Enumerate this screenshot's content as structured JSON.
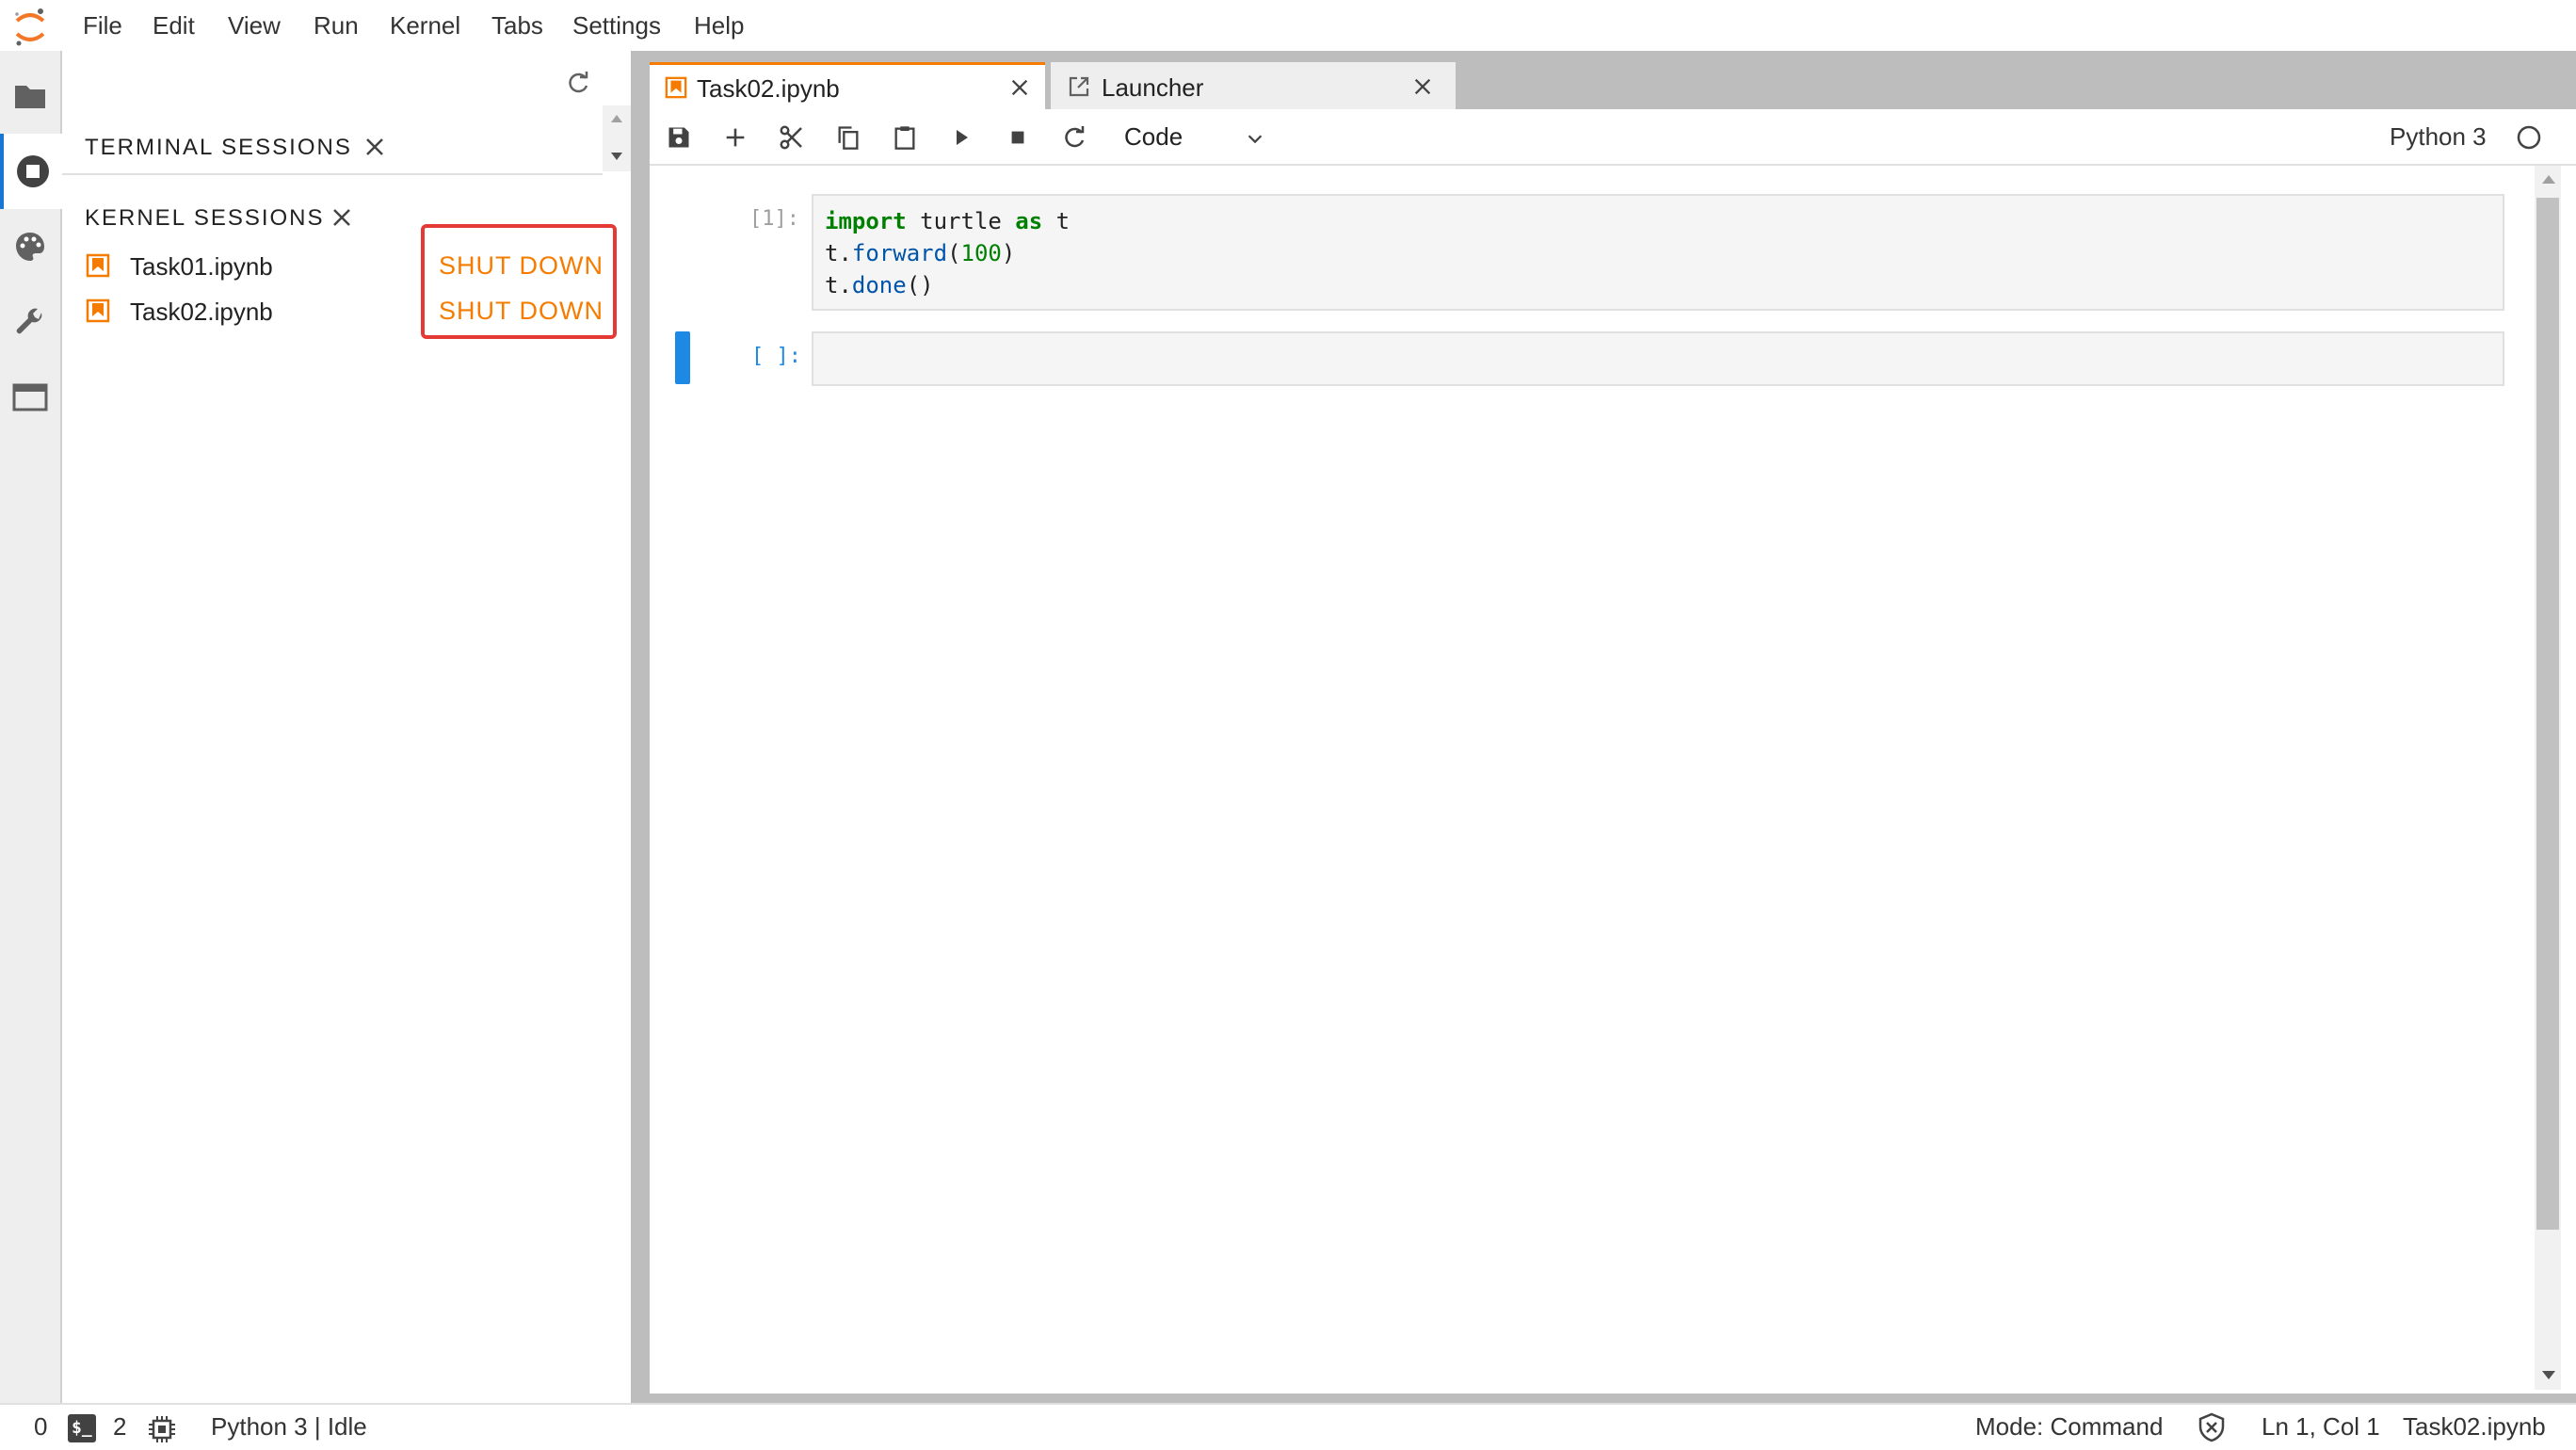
{
  "menubar": {
    "items": [
      "File",
      "Edit",
      "View",
      "Run",
      "Kernel",
      "Tabs",
      "Settings",
      "Help"
    ]
  },
  "sidebar": {
    "terminal_sessions_title": "TERMINAL SESSIONS",
    "kernel_sessions_title": "KERNEL SESSIONS",
    "sessions": [
      {
        "name": "Task01.ipynb",
        "action": "SHUT DOWN"
      },
      {
        "name": "Task02.ipynb",
        "action": "SHUT DOWN"
      }
    ]
  },
  "tabs": [
    {
      "label": "Task02.ipynb",
      "icon": "notebook-icon"
    },
    {
      "label": "Launcher",
      "icon": "launcher-icon"
    }
  ],
  "toolbar": {
    "cell_type": "Code",
    "kernel_name": "Python 3"
  },
  "cells": [
    {
      "prompt": "[1]:",
      "lines": [
        "import turtle as t",
        "t.forward(100)",
        "t.done()"
      ]
    },
    {
      "prompt": "[ ]:",
      "lines": []
    }
  ],
  "statusbar": {
    "terminals_count": "0",
    "kernels_count": "2",
    "kernel_status": "Python 3 | Idle",
    "mode": "Mode: Command",
    "cursor": "Ln 1, Col 1",
    "file": "Task02.ipynb"
  },
  "colors": {
    "accent": "#f57c00",
    "highlight_box": "#e53935",
    "active_cell_marker": "#1e88e5"
  }
}
